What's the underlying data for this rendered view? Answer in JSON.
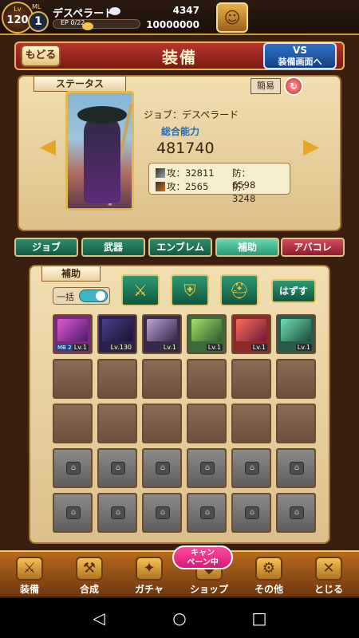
{
  "topbar": {
    "lv_label": "Lv",
    "level": "120",
    "ml_label": "ML",
    "ml_level": "1",
    "player_name": "デスペラード",
    "exp_text": "EP 0/22",
    "exp_fraction": 0.0,
    "gems": "4347",
    "gold": "10000000",
    "menu_icon": "character-portrait-icon"
  },
  "header": {
    "back_label": "もどる",
    "title": "装備",
    "vs_line1": "VS",
    "vs_line2": "装備画面へ"
  },
  "status": {
    "tag": "ステータス",
    "simple_label": "簡易",
    "job_line": "ジョブ：デスペラード",
    "power_label": "総合能力",
    "power_value": "481740",
    "phys_attack": "攻：32811",
    "phys_defense": "防：6598",
    "mag_attack": "攻：2565",
    "mag_defense": "防：3248"
  },
  "tabs": [
    {
      "label": "ジョブ"
    },
    {
      "label": "武器"
    },
    {
      "label": "エンブレム"
    },
    {
      "label": "補助"
    },
    {
      "label": "アバコレ"
    }
  ],
  "assist": {
    "tag": "補助",
    "bulk_label": "一括",
    "remove_label": "はずす",
    "slot_icons": [
      "sword-icon",
      "armor-icon",
      "helmet-icon"
    ],
    "cards": [
      {
        "lv": "Lv.1",
        "mb": "MB 2"
      },
      {
        "lv": "Lv.130",
        "mb": ""
      },
      {
        "lv": "Lv.1",
        "mb": ""
      },
      {
        "lv": "Lv.1",
        "mb": ""
      },
      {
        "lv": "Lv.1",
        "mb": ""
      },
      {
        "lv": "Lv.1",
        "mb": ""
      }
    ]
  },
  "bottom_nav": [
    {
      "label": "装備",
      "icon": "equip-icon"
    },
    {
      "label": "合成",
      "icon": "hammer-icon"
    },
    {
      "label": "ガチャ",
      "icon": "gacha-icon"
    },
    {
      "label": "ショップ",
      "icon": "shop-icon"
    },
    {
      "label": "その他",
      "icon": "gear-icon"
    },
    {
      "label": "とじる",
      "icon": "close-icon"
    }
  ],
  "campaign": {
    "line1": "キャン",
    "line2": "ペーン中"
  },
  "colors": {
    "accent": "#e2b24a",
    "tab_green": "#145a43",
    "tab_red": "#8c1d2c",
    "title_red": "#b8342a"
  }
}
